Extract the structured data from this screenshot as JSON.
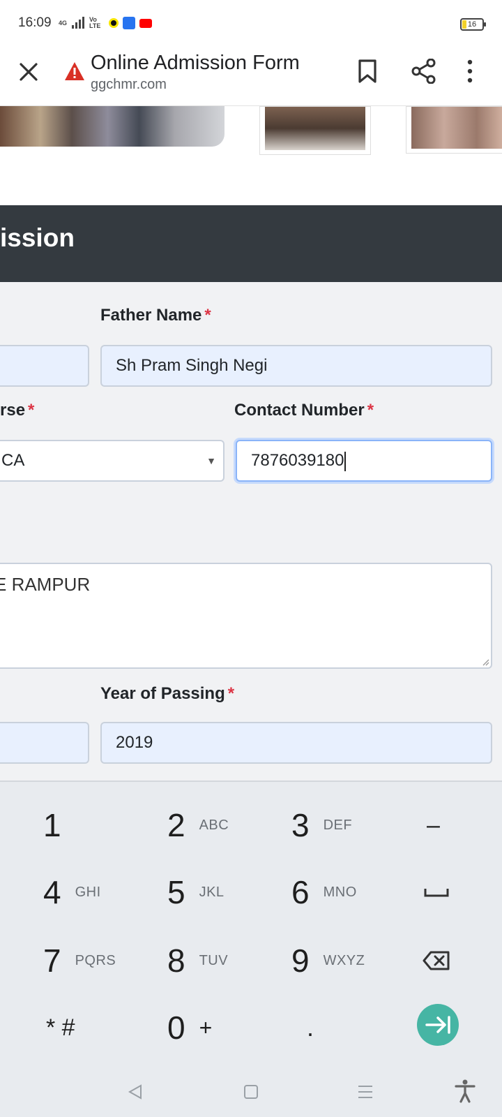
{
  "status_bar": {
    "time": "16:09",
    "network": "4G",
    "volte": "Vo LTE",
    "battery": "16"
  },
  "header": {
    "title": "Online Admission Form",
    "domain": "ggchmr.com"
  },
  "banner": {
    "text": "ission"
  },
  "form": {
    "father_name_label": "Father Name",
    "father_name_value": "Sh Pram Singh Negi",
    "course_label": "rse",
    "course_value": "CA",
    "contact_label": "Contact Number",
    "contact_value": "7876039180",
    "address_value": "E RAMPUR",
    "year_label": "Year of Passing",
    "year_value": "2019",
    "required_mark": "*"
  },
  "keyboard": {
    "keys": [
      {
        "num": "1",
        "sub": ""
      },
      {
        "num": "2",
        "sub": "ABC"
      },
      {
        "num": "3",
        "sub": "DEF"
      },
      {
        "num": "4",
        "sub": "GHI"
      },
      {
        "num": "5",
        "sub": "JKL"
      },
      {
        "num": "6",
        "sub": "MNO"
      },
      {
        "num": "7",
        "sub": "PQRS"
      },
      {
        "num": "8",
        "sub": "TUV"
      },
      {
        "num": "9",
        "sub": "WXYZ"
      },
      {
        "num": "* #",
        "sub": ""
      },
      {
        "num": "0",
        "sub": "+"
      },
      {
        "num": ".",
        "sub": ""
      }
    ],
    "dash": "–",
    "accent_color": "#46b5a4"
  }
}
